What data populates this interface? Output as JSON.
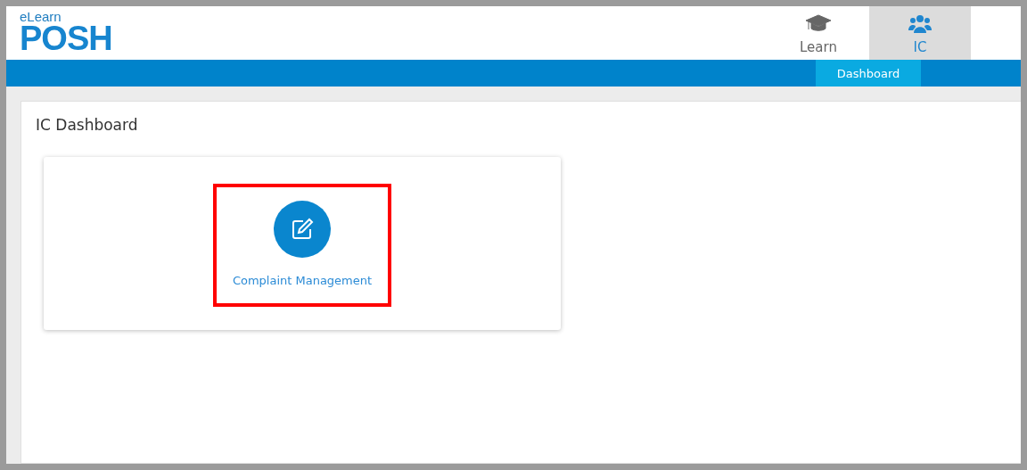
{
  "logo": {
    "top": "eLearn",
    "main": "POSH"
  },
  "tabs": [
    {
      "label": "Learn",
      "kind": "learn",
      "selected": false
    },
    {
      "label": "IC",
      "kind": "group",
      "selected": true
    }
  ],
  "subnav": [
    {
      "label": "Dashboard",
      "selected": true
    }
  ],
  "page": {
    "title": "IC Dashboard",
    "tiles": [
      {
        "label": "Complaint Management",
        "highlighted": true
      }
    ]
  }
}
